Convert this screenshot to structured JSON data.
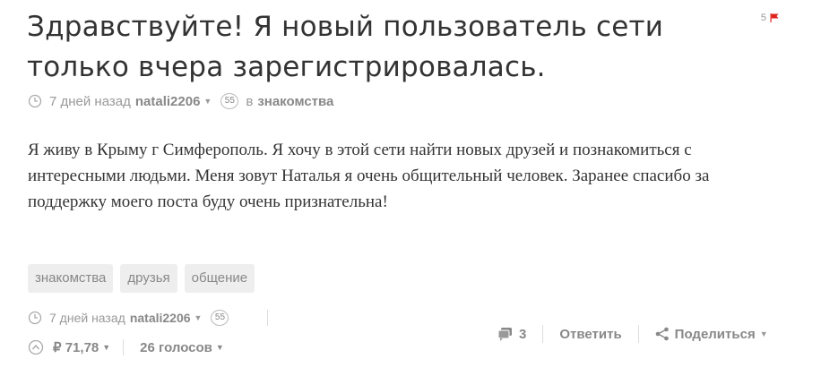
{
  "post": {
    "title": "Здравствуйте! Я новый пользователь сети только вчера зарегистрировалась.",
    "flag_count": "5",
    "meta_top": {
      "time": "7 дней назад",
      "author": "natali2206",
      "rep": "55",
      "in": "в",
      "blog": "знакомства"
    },
    "body": "Я живу в Крыму г Симферополь. Я хочу в этой сети найти новых друзей и познакомиться с интересными людьми. Меня зовут Наталья я очень общительный человек. Заранее спасибо за поддержку моего поста буду очень признательна!",
    "tags": [
      "знакомства",
      "друзья",
      "общение"
    ],
    "meta_bottom": {
      "time": "7 дней назад",
      "author": "natali2206",
      "rep": "55"
    },
    "payout": "₽ 71,78",
    "votes": "26 голосов",
    "comments_count": "3",
    "reply_label": "Ответить",
    "share_label": "Поделиться"
  },
  "icons": {
    "clock": "clock-icon",
    "flag": "flag-icon",
    "upvote": "upvote-icon",
    "comments": "comments-icon",
    "share": "share-icon",
    "caret": "caret-down-icon"
  },
  "colors": {
    "flag": "#e0231c",
    "text": "#333333",
    "muted": "#999999",
    "tag_bg": "#eeeeee"
  }
}
